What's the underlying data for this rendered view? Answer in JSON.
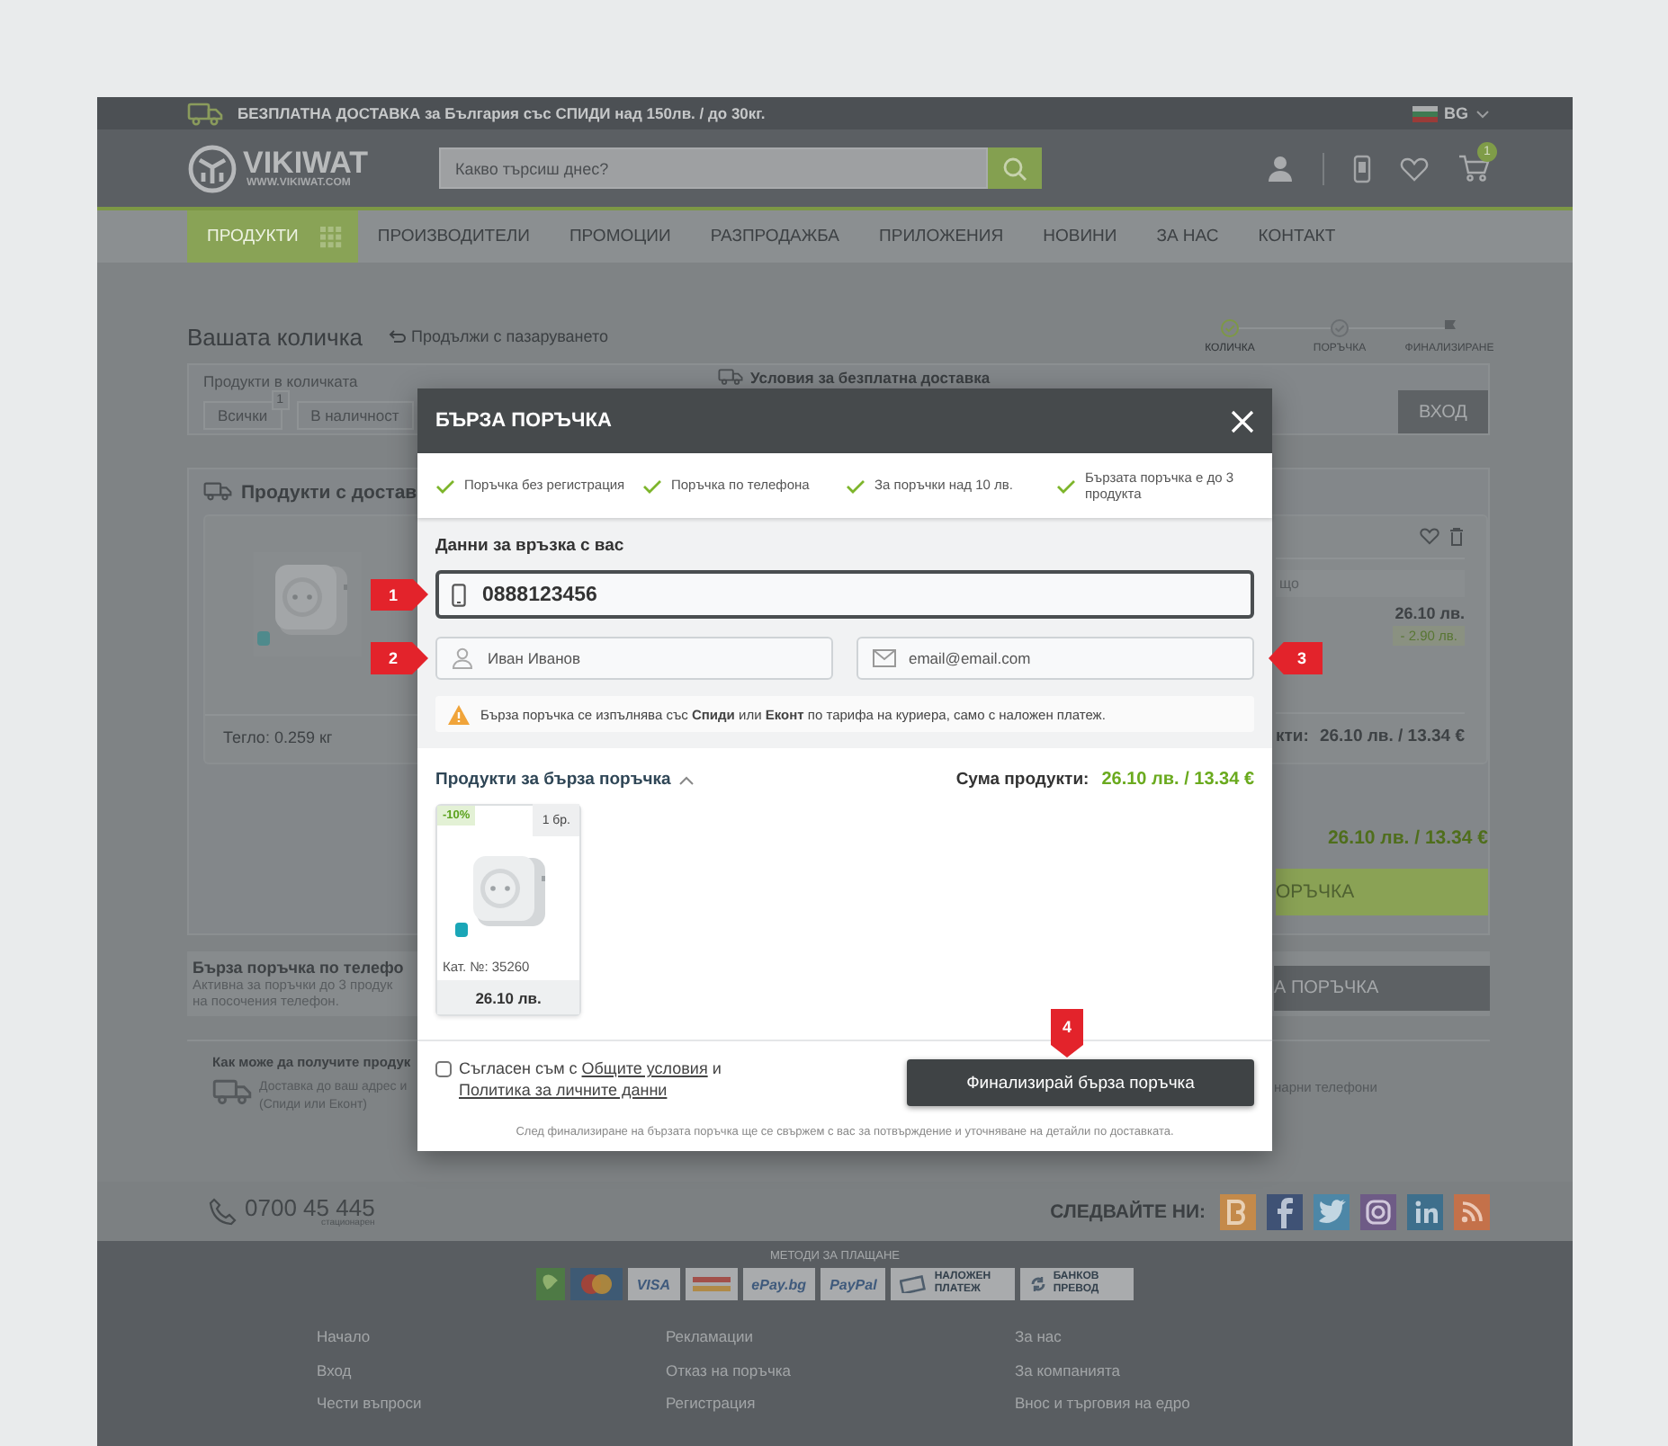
{
  "top_bar": {
    "text": "БЕЗПЛАТНА ДОСТАВКА за България със СПИДИ над 150лв. / до 30кг.",
    "language": "BG"
  },
  "header": {
    "logo": "VIKIWAT",
    "logo_url": "WWW.VIKIWAT.COM",
    "search": {
      "placeholder": "Какво търсиш днес?"
    },
    "cart_count": "1"
  },
  "nav": [
    {
      "label": "ПРОДУКТИ",
      "selected": true
    },
    {
      "label": "ПРОИЗВОДИТЕЛИ",
      "selected": false
    },
    {
      "label": "ПРОМОЦИИ",
      "selected": false
    },
    {
      "label": "РАЗПРОДАЖБА",
      "selected": false
    },
    {
      "label": "ПРИЛОЖЕНИЯ",
      "selected": false
    },
    {
      "label": "НОВИНИ",
      "selected": false
    },
    {
      "label": "ЗА НАС",
      "selected": false
    },
    {
      "label": "КОНТАКТ",
      "selected": false
    }
  ],
  "cart": {
    "title": "Вашата количка",
    "continue_link": "Продължи с пазаруването",
    "steps": [
      {
        "label": "КОЛИЧКА",
        "kind": "check",
        "done": true
      },
      {
        "label": "ПОРЪЧКА",
        "kind": "check",
        "done": false
      },
      {
        "label": "ФИНАЛИЗИРАНЕ",
        "kind": "flag",
        "done": false
      }
    ],
    "filter_title": "Продукти в количката",
    "filters": [
      {
        "label": "Всички",
        "count": "1"
      },
      {
        "label": "В наличност"
      }
    ],
    "free_delivery_link": "Условия за безплатна доставка",
    "login_button": "ВХОД",
    "section_title": "Продукти с достав",
    "product": {
      "weight": "Тегло: 0.259 кг",
      "note": "що",
      "price": "26.10 лв.",
      "discount": "- 2.90 лв.",
      "subtotal_label": "кти:",
      "subtotal": "26.10 лв. / 13.34 €"
    },
    "total": "26.10 лв. / 13.34 €",
    "order_button": "ОРЪЧКА",
    "quick_phone": {
      "title": "Бърза поръчка по телефо",
      "lines": [
        "Активна за поръчки до 3 продук",
        "на посочения телефон."
      ],
      "button": "А ПОРЪЧКА"
    },
    "delivery": {
      "title": "Как може да получите продук",
      "lines": [
        "Доставка до ваш адрес и",
        "(Спиди или Еконт)"
      ],
      "right_text": "нарни телефони"
    }
  },
  "footer": {
    "phone": "0700 45 445",
    "phone_note": "стационарен",
    "follow": "СЛЕДВАЙТЕ НИ:",
    "payments_title": "МЕТОДИ ЗА ПЛАЩАНЕ",
    "payments": [
      {
        "kind": "emblem"
      },
      {
        "kind": "circles"
      },
      {
        "kind": "text",
        "label": "VISA"
      },
      {
        "kind": "securecode"
      },
      {
        "kind": "text",
        "label": "ePay.bg"
      },
      {
        "kind": "text",
        "label": "PayPal"
      },
      {
        "kind": "cash",
        "label": "НАЛОЖЕН ПЛАТЕЖ"
      },
      {
        "kind": "transfer",
        "label": "БАНКОВ ПРЕВОД"
      }
    ],
    "link_columns": [
      [
        "Начало",
        "Вход",
        "Чести въпроси"
      ],
      [
        "Рекламации",
        "Отказ на поръчка",
        "Регистрация"
      ],
      [
        "За нас",
        "За компанията",
        "Внос и търговия на едро"
      ]
    ]
  },
  "quick_order": {
    "title": "БЪРЗА ПОРЪЧКА",
    "benefits": [
      "Поръчка без регистрация",
      "Поръчка по телефона",
      "За поръчки над 10 лв.",
      "Бързата поръчка е до 3 продукта"
    ],
    "contact_title": "Данни за връзка с вас",
    "phone": {
      "value": "0888123456",
      "marker": "1"
    },
    "name": {
      "placeholder": "Иван Иванов",
      "marker": "2"
    },
    "email": {
      "placeholder": "email@email.com",
      "marker": "3"
    },
    "notice": "Бърза поръчка се изпълнява със **Спиди** или **Еконт** по тарифа на куриера, само с наложен платеж.",
    "products_title": "Продукти за бърза поръчка",
    "expanded": true,
    "sum_label": "Сума продукти:",
    "sum": "26.10 лв. / 13.34 €",
    "products": [
      {
        "discount": "-10%",
        "quantity": "1 бр.",
        "code": "Кат. №: 35260",
        "price": "26.10 лв."
      }
    ],
    "consent": {
      "checked": false,
      "prefix": "Съгласен съм с",
      "link_terms": "Общите условия",
      "joiner": "и",
      "link_privacy": "Политика за личните данни"
    },
    "submit": {
      "label": "Финализирай бърза поръчка",
      "marker": "4"
    },
    "footnote": "След финализиране на бързата поръчка ще се свържем с вас за потвърждение и уточняване на детайли по доставката."
  }
}
